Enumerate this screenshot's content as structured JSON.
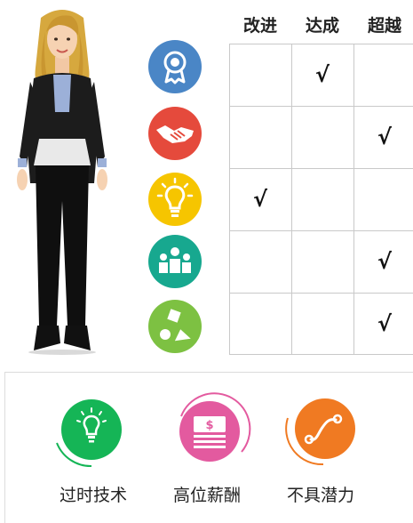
{
  "matrix": {
    "columns": [
      "改进",
      "达成",
      "超越"
    ],
    "rows": [
      {
        "icon": "award-ribbon-icon",
        "color": "#4a86c6",
        "mark_column": 1
      },
      {
        "icon": "handshake-icon",
        "color": "#e54a3c",
        "mark_column": 2
      },
      {
        "icon": "lightbulb-icon",
        "color": "#f6c500",
        "mark_column": 0
      },
      {
        "icon": "team-people-icon",
        "color": "#17a88f",
        "mark_column": 2
      },
      {
        "icon": "shapes-icon",
        "color": "#7dc142",
        "mark_column": 2
      }
    ],
    "mark_symbol": "√"
  },
  "flags": [
    {
      "label": "过时技术",
      "icon": "lightbulb-icon",
      "color": "#15b556"
    },
    {
      "label": "高位薪酬",
      "icon": "money-stack-icon",
      "color": "#e35a9f"
    },
    {
      "label": "不具潜力",
      "icon": "trend-curve-icon",
      "color": "#f07a22"
    }
  ]
}
